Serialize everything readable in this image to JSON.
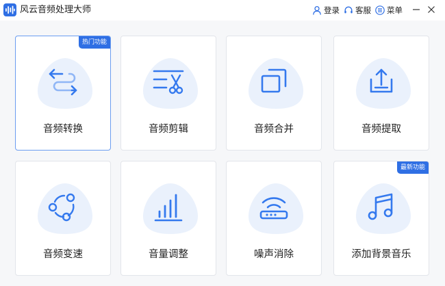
{
  "window": {
    "title": "风云音频处理大师",
    "actions": {
      "login": "登录",
      "service": "客服",
      "menu": "菜单"
    },
    "controls": {
      "minimize": "minimize-icon",
      "close": "close-icon"
    }
  },
  "colors": {
    "accent": "#2f6fe4",
    "icon_blue": "#3479ee",
    "blob": "#eaf1fc",
    "card_border": "#e2e5ea",
    "active_border": "#6a9cf0"
  },
  "tools": [
    {
      "label": "音频转换",
      "icon": "convert-arrows-icon",
      "badge": "热门功能",
      "selected": true
    },
    {
      "label": "音频剪辑",
      "icon": "scissors-cut-icon",
      "badge": "",
      "selected": false
    },
    {
      "label": "音频合并",
      "icon": "merge-squares-icon",
      "badge": "",
      "selected": false
    },
    {
      "label": "音频提取",
      "icon": "extract-upload-icon",
      "badge": "",
      "selected": false
    },
    {
      "label": "音频变速",
      "icon": "speed-cycle-icon",
      "badge": "",
      "selected": false
    },
    {
      "label": "音量调整",
      "icon": "volume-bars-icon",
      "badge": "",
      "selected": false
    },
    {
      "label": "噪声消除",
      "icon": "noise-router-icon",
      "badge": "",
      "selected": false
    },
    {
      "label": "添加背景音乐",
      "icon": "music-note-icon",
      "badge": "最新功能",
      "selected": false
    }
  ]
}
